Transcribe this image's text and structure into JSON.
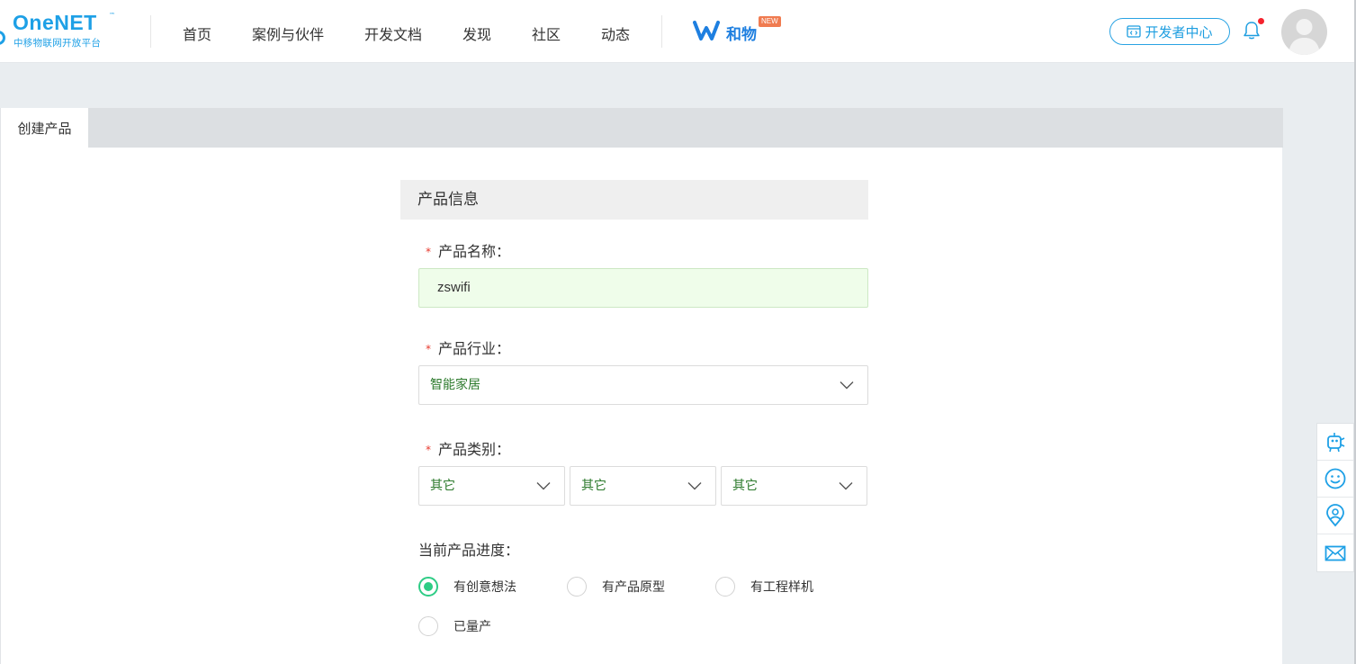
{
  "header": {
    "logo_main": "OneNET",
    "logo_tm": "™",
    "logo_sub": "中移物联网开放平台",
    "nav": [
      "首页",
      "案例与伙伴",
      "开发文档",
      "发现",
      "社区",
      "动态"
    ],
    "hewu_label": "和物",
    "new_badge": "NEW",
    "dev_center": "开发者中心"
  },
  "tabs": [
    "创建产品"
  ],
  "form": {
    "section_title": "产品信息",
    "required_mark": "*",
    "name_label": "产品名称：",
    "name_value": "zswifi",
    "industry_label": "产品行业：",
    "industry_value": "智能家居",
    "category_label": "产品类别：",
    "category_values": [
      "其它",
      "其它",
      "其它"
    ],
    "progress_label": "当前产品进度：",
    "progress_options": [
      "有创意想法",
      "有产品原型",
      "有工程样机",
      "已量产"
    ],
    "progress_selected": 0
  },
  "colors": {
    "brand": "#1ea0e6",
    "required": "#e8382d",
    "radio_checked": "#2ecc85",
    "select_text": "#2c7a2c",
    "input_bg": "#effdea"
  },
  "float_icons": [
    "robot-icon",
    "smile-icon",
    "location-icon",
    "mail-icon"
  ]
}
